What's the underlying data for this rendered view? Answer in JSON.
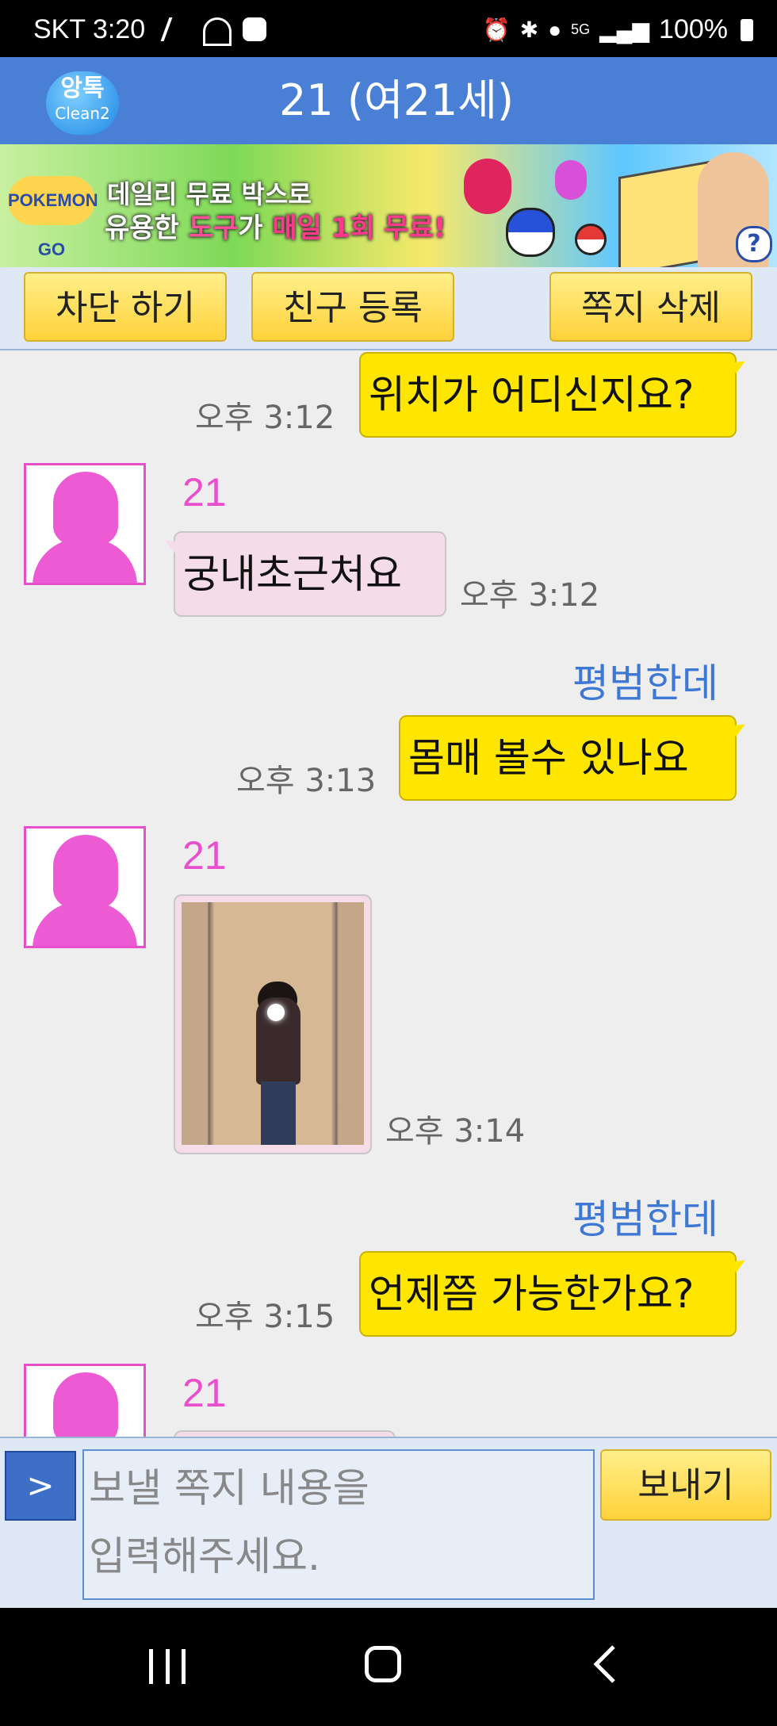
{
  "status_bar": {
    "carrier_time": "SKT 3:20",
    "network": "5G",
    "battery": "100%"
  },
  "header": {
    "logo_top": "앙톡",
    "logo_bottom": "Clean2",
    "title": "21 (여21세)"
  },
  "banner": {
    "game": "POKEMON GO",
    "line1": "데일리 무료 박스로",
    "line2_pre": "유용한 ",
    "line2_hl1": "도구",
    "line2_mid": "가 ",
    "line2_hl2": "매일 1회 무료!",
    "help": "?"
  },
  "actions": {
    "block": "차단 하기",
    "add_friend": "친구 등록",
    "delete": "쪽지 삭제"
  },
  "messages": [
    {
      "from": "me",
      "text": "위치가 어디신지요?",
      "time": "오후 3:12"
    },
    {
      "from": "her",
      "nick": "21",
      "text": "궁내초근처요",
      "time": "오후 3:12"
    },
    {
      "from": "me",
      "nick": "평범한데",
      "text": "몸매 볼수 있나요",
      "time": "오후 3:13"
    },
    {
      "from": "her",
      "nick": "21",
      "type": "photo",
      "time": "오후 3:14"
    },
    {
      "from": "me",
      "nick": "평범한데",
      "text": "언제쯤 가능한가요?",
      "time": "오후 3:15"
    },
    {
      "from": "her",
      "nick": "21"
    }
  ],
  "composer": {
    "expand": ">",
    "placeholder": "보낼 쪽지 내용을\n입력해주세요.",
    "send": "보내기"
  },
  "colors": {
    "header_blue": "#4a7fd6",
    "my_bubble": "#ffe600",
    "her_bubble": "#f4dde9",
    "her_nick": "#e84fcc",
    "my_nick": "#3d78d4"
  }
}
